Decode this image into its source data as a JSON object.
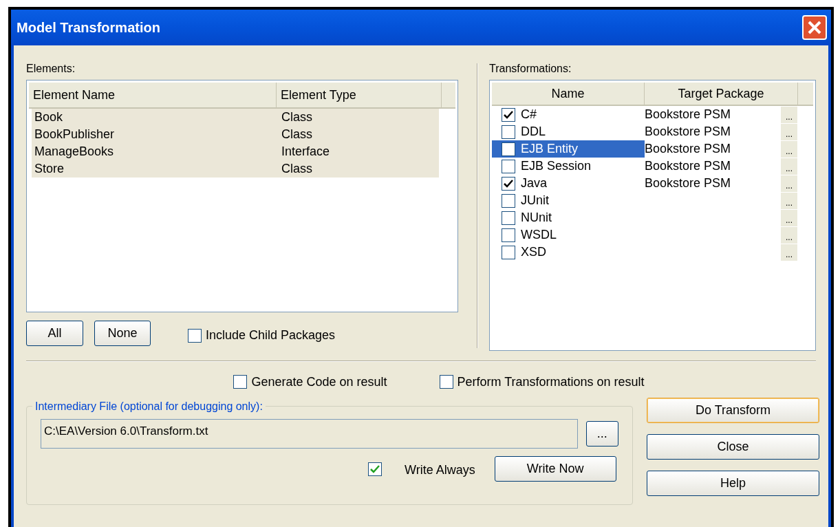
{
  "window": {
    "title": "Model Transformation"
  },
  "elements": {
    "label": "Elements:",
    "columns": [
      "Element Name",
      "Element Type"
    ],
    "rows": [
      {
        "name": "Book",
        "type": "Class"
      },
      {
        "name": "BookPublisher",
        "type": "Class"
      },
      {
        "name": "ManageBooks",
        "type": "Interface"
      },
      {
        "name": "Store",
        "type": "Class"
      }
    ]
  },
  "element_buttons": [
    "All",
    "None"
  ],
  "include_child_packages": {
    "label": "Include Child Packages",
    "checked": false
  },
  "transformations": {
    "label": "Transformations:",
    "columns": [
      "Name",
      "Target Package"
    ],
    "rows": [
      {
        "name": "C#",
        "target": "Bookstore PSM",
        "checked": true,
        "selected": false,
        "browse": "..."
      },
      {
        "name": "DDL",
        "target": "Bookstore PSM",
        "checked": false,
        "selected": false,
        "browse": "..."
      },
      {
        "name": "EJB Entity",
        "target": "Bookstore PSM",
        "checked": false,
        "selected": true,
        "browse": "..."
      },
      {
        "name": "EJB Session",
        "target": "Bookstore PSM",
        "checked": false,
        "selected": false,
        "browse": "..."
      },
      {
        "name": "Java",
        "target": "Bookstore PSM",
        "checked": true,
        "selected": false,
        "browse": "..."
      },
      {
        "name": "JUnit",
        "checked": false,
        "selected": false,
        "browse": "..."
      },
      {
        "name": "NUnit",
        "checked": false,
        "selected": false,
        "browse": "..."
      },
      {
        "name": "WSDL",
        "checked": false,
        "selected": false,
        "browse": "..."
      },
      {
        "name": "XSD",
        "checked": false,
        "selected": false,
        "browse": "..."
      }
    ]
  },
  "options": [
    {
      "label": "Generate Code on result",
      "checked": false
    },
    {
      "label": "Perform Transformations on result",
      "checked": false
    }
  ],
  "intermediary_file": {
    "legend": "Intermediary File (optional for debugging only):",
    "value": "C:\\EA\\Version 6.0\\Transform.txt",
    "browse": "...",
    "write_always": {
      "label": "Write Always",
      "checked": true
    },
    "write_now": "Write Now"
  },
  "actions": [
    {
      "label": "Do Transform",
      "focused": true
    },
    {
      "label": "Close",
      "focused": false
    },
    {
      "label": "Help",
      "focused": false
    }
  ]
}
